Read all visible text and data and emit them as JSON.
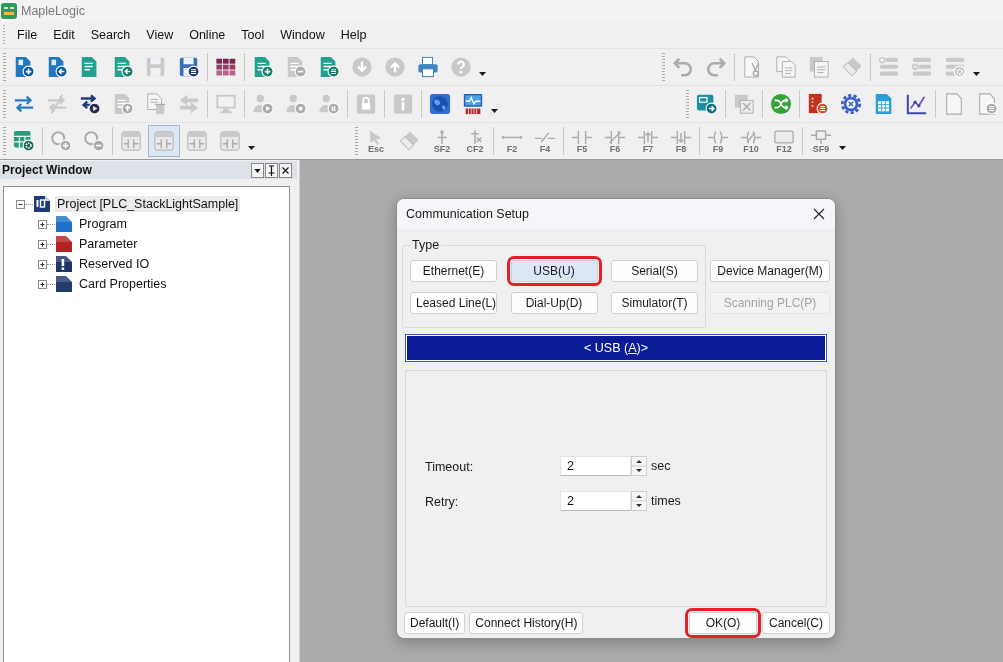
{
  "app": {
    "title": "MapleLogic"
  },
  "menu": [
    "File",
    "Edit",
    "Search",
    "View",
    "Online",
    "Tool",
    "Window",
    "Help"
  ],
  "toolbars": [
    {
      "bands": [
        {
          "groups": [
            {
              "dropdown": false,
              "items": [
                {
                  "disabled": false
                },
                {
                  "disabled": false
                },
                {
                  "disabled": false
                },
                {
                  "disabled": false
                },
                {
                  "disabled": true
                },
                {
                  "disabled": false
                }
              ]
            },
            {
              "dropdown": false,
              "items": [
                {
                  "disabled": false
                }
              ]
            },
            {
              "dropdown": true,
              "items": [
                {
                  "disabled": false
                },
                {
                  "disabled": true
                },
                {
                  "disabled": false
                },
                {
                  "disabled": true
                },
                {
                  "disabled": true
                },
                {
                  "disabled": false
                },
                {
                  "disabled": true
                }
              ]
            }
          ]
        },
        {
          "groups": [
            {
              "dropdown": false,
              "items": [
                {
                  "disabled": true
                },
                {
                  "disabled": true
                }
              ]
            },
            {
              "dropdown": false,
              "items": [
                {
                  "disabled": true
                },
                {
                  "disabled": true
                },
                {
                  "disabled": true
                },
                {
                  "disabled": true
                }
              ]
            },
            {
              "dropdown": true,
              "items": [
                {
                  "disabled": true
                },
                {
                  "disabled": true
                },
                {
                  "disabled": true
                }
              ]
            }
          ]
        }
      ]
    },
    {
      "bands": [
        {
          "groups": [
            {
              "dropdown": false,
              "items": [
                {
                  "disabled": false
                },
                {
                  "disabled": true
                },
                {
                  "disabled": false
                },
                {
                  "disabled": true
                },
                {
                  "disabled": true
                },
                {
                  "disabled": true
                }
              ]
            },
            {
              "dropdown": false,
              "items": [
                {
                  "disabled": true
                }
              ]
            },
            {
              "dropdown": false,
              "items": [
                {
                  "disabled": true
                },
                {
                  "disabled": true
                },
                {
                  "disabled": true
                }
              ]
            },
            {
              "dropdown": false,
              "items": [
                {
                  "disabled": true
                }
              ]
            },
            {
              "dropdown": false,
              "items": [
                {
                  "disabled": true
                }
              ]
            },
            {
              "dropdown": true,
              "items": [
                {
                  "disabled": false
                },
                {
                  "disabled": false
                }
              ]
            }
          ]
        },
        {
          "groups": [
            {
              "dropdown": false,
              "items": [
                {
                  "disabled": false
                }
              ]
            },
            {
              "dropdown": false,
              "items": [
                {
                  "disabled": true
                }
              ]
            },
            {
              "dropdown": false,
              "items": [
                {
                  "disabled": false
                }
              ]
            },
            {
              "dropdown": false,
              "items": [
                {
                  "disabled": false
                },
                {
                  "disabled": false
                },
                {
                  "disabled": false
                },
                {
                  "disabled": false
                }
              ]
            },
            {
              "dropdown": false,
              "items": [
                {
                  "disabled": true
                },
                {
                  "disabled": true
                }
              ]
            }
          ]
        }
      ]
    },
    {
      "bands": [
        {
          "groups": [
            {
              "dropdown": false,
              "items": [
                {
                  "disabled": false
                }
              ]
            },
            {
              "dropdown": false,
              "items": [
                {
                  "disabled": true
                },
                {
                  "disabled": true
                }
              ]
            },
            {
              "dropdown": true,
              "items": [
                {
                  "disabled": true,
                  "pressed": false
                },
                {
                  "disabled": true,
                  "pressed": true
                },
                {
                  "disabled": true,
                  "pressed": false
                },
                {
                  "disabled": true,
                  "pressed": false
                }
              ]
            }
          ]
        },
        {
          "groups": [
            {
              "dropdown": false,
              "items": [
                {
                  "disabled": true,
                  "key": "Esc"
                },
                {
                  "disabled": true
                },
                {
                  "disabled": true,
                  "key": "SF2"
                },
                {
                  "disabled": true,
                  "key": "CF2"
                }
              ]
            },
            {
              "dropdown": false,
              "items": [
                {
                  "disabled": true,
                  "key": "F2"
                },
                {
                  "disabled": true,
                  "key": "F4"
                }
              ]
            },
            {
              "dropdown": false,
              "items": [
                {
                  "disabled": true,
                  "key": "F5"
                },
                {
                  "disabled": true,
                  "key": "F6"
                },
                {
                  "disabled": true,
                  "key": "F7"
                },
                {
                  "disabled": true,
                  "key": "F8"
                }
              ]
            },
            {
              "dropdown": false,
              "items": [
                {
                  "disabled": true,
                  "key": "F9"
                },
                {
                  "disabled": true,
                  "key": "F10"
                },
                {
                  "disabled": true,
                  "key": "F12"
                }
              ]
            },
            {
              "dropdown": true,
              "items": [
                {
                  "disabled": true,
                  "key": "SF9"
                }
              ]
            }
          ]
        }
      ]
    }
  ],
  "project_window": {
    "title": "Project Window",
    "tree": [
      {
        "label": "Project [PLC_StackLightSample]",
        "expanded": true,
        "selected": true,
        "children": [
          {
            "label": "Program",
            "expanded": false,
            "selected": false
          },
          {
            "label": "Parameter",
            "expanded": false,
            "selected": false
          },
          {
            "label": "Reserved IO",
            "expanded": false,
            "selected": false
          },
          {
            "label": "Card Properties",
            "expanded": false,
            "selected": false
          }
        ]
      }
    ]
  },
  "dialog": {
    "title": "Communication Setup",
    "type_group": {
      "label": "Type",
      "buttons": [
        {
          "label": "Ethernet(E)",
          "selected": false,
          "highlighted": false
        },
        {
          "label": "USB(U)",
          "selected": true,
          "highlighted": true
        },
        {
          "label": "Serial(S)",
          "selected": false,
          "highlighted": false
        },
        {
          "label": "Leased Line(L)",
          "selected": false,
          "highlighted": false
        },
        {
          "label": "Dial-Up(D)",
          "selected": false,
          "highlighted": false
        },
        {
          "label": "Simulator(T)",
          "selected": false,
          "highlighted": false
        }
      ]
    },
    "side_buttons": [
      {
        "label": "Device Manager(M)",
        "disabled": false
      },
      {
        "label": "Scanning PLC(P)",
        "disabled": true
      }
    ],
    "banner": {
      "before": "< USB (",
      "mnemonic": "A",
      "after": ")>"
    },
    "settings": [
      {
        "label": "Timeout:",
        "value": "2",
        "unit": "sec"
      },
      {
        "label": "Retry:",
        "value": "2",
        "unit": "times"
      }
    ],
    "footer_left": [
      {
        "label": "Default(I)",
        "highlighted": false
      },
      {
        "label": "Connect History(H)",
        "highlighted": false
      }
    ],
    "footer_right": [
      {
        "label": "OK(O)",
        "highlighted": true
      },
      {
        "label": "Cancel(C)",
        "highlighted": false
      }
    ]
  }
}
